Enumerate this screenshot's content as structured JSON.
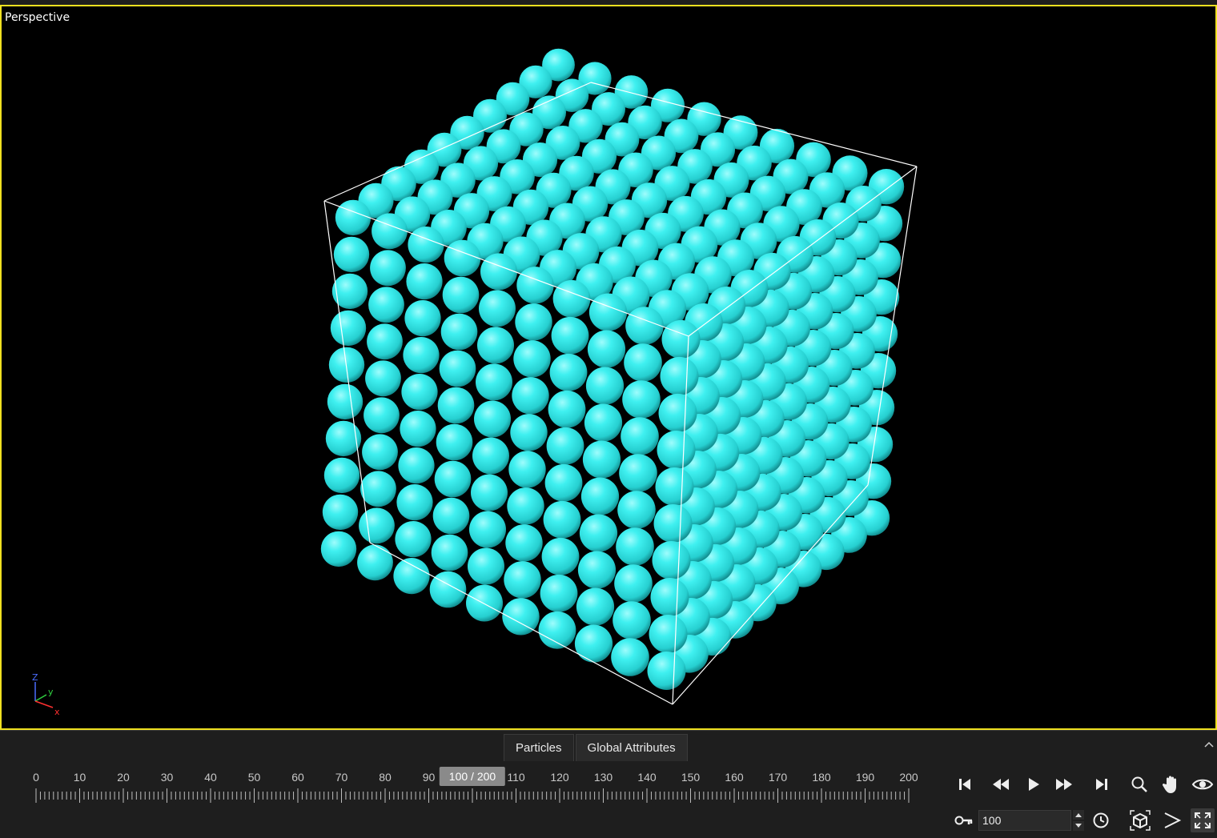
{
  "viewport": {
    "label": "Perspective",
    "sphere_color": "#33e8e8",
    "border_color": "#f0e020",
    "axis_labels": {
      "z": "Z",
      "y": "y",
      "x": "x"
    }
  },
  "tabs": [
    {
      "label": "Particles"
    },
    {
      "label": "Global Attributes"
    }
  ],
  "timeline": {
    "ticks": [
      "0",
      "10",
      "20",
      "30",
      "40",
      "50",
      "60",
      "70",
      "80",
      "90",
      "100",
      "110",
      "120",
      "130",
      "140",
      "150",
      "160",
      "170",
      "180",
      "190",
      "200"
    ],
    "current_frame": 100,
    "total_frames": 200,
    "cursor_label": "100 / 200"
  },
  "controls": {
    "frame_value": "100",
    "icons": {
      "first": "skip-to-start-icon",
      "prev": "rewind-icon",
      "play": "play-icon",
      "next": "fast-forward-icon",
      "last": "skip-to-end-icon",
      "zoom": "search-icon",
      "pan": "hand-icon",
      "orbit": "eye-icon",
      "key": "key-icon",
      "clock": "clock-icon",
      "view_cube": "cube-icon",
      "perspective": "perspective-icon",
      "maximize": "maximize-icon"
    }
  }
}
